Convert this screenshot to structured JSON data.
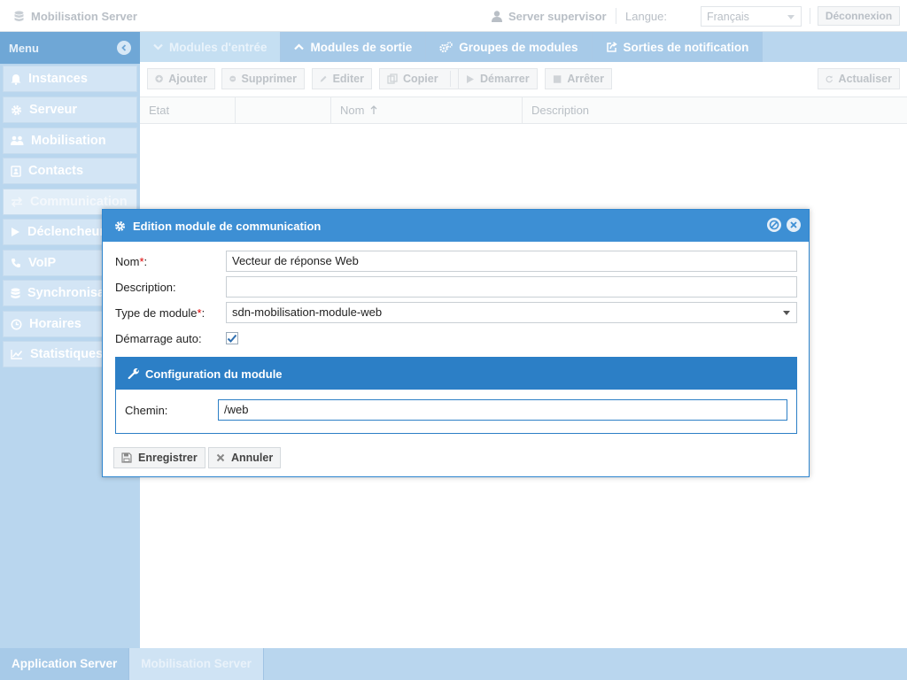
{
  "topbar": {
    "app_title": "Mobilisation Server",
    "user": "Server supervisor",
    "language_label": "Langue:",
    "language_value": "Français",
    "logout_label": "Déconnexion"
  },
  "sidebar": {
    "header": "Menu",
    "items": [
      {
        "label": "Instances",
        "icon": "bell-icon"
      },
      {
        "label": "Serveur",
        "icon": "gear-icon"
      },
      {
        "label": "Mobilisation",
        "icon": "users-icon"
      },
      {
        "label": "Contacts",
        "icon": "contact-card-icon"
      },
      {
        "label": "Communication",
        "icon": "exchange-icon"
      },
      {
        "label": "Déclencheurs",
        "icon": "play-icon"
      },
      {
        "label": "VoIP",
        "icon": "phone-icon"
      },
      {
        "label": "Synchronisation",
        "icon": "database-icon"
      },
      {
        "label": "Horaires",
        "icon": "clock-icon"
      },
      {
        "label": "Statistiques",
        "icon": "chart-line-icon"
      }
    ]
  },
  "tabs": [
    {
      "label": "Modules d'entrée",
      "icon": "chevron-down-icon"
    },
    {
      "label": "Modules de sortie",
      "icon": "chevron-up-icon"
    },
    {
      "label": "Groupes de modules",
      "icon": "gears-icon"
    },
    {
      "label": "Sorties de notification",
      "icon": "share-icon"
    }
  ],
  "toolbar": {
    "add": "Ajouter",
    "delete": "Supprimer",
    "edit": "Editer",
    "copy": "Copier",
    "start": "Démarrer",
    "stop": "Arrêter",
    "refresh": "Actualiser"
  },
  "table": {
    "columns": [
      "Etat",
      "",
      "Nom",
      "Description"
    ]
  },
  "dialog": {
    "title": "Edition module de communication",
    "name_label": "Nom",
    "name_value": "Vecteur de réponse Web",
    "description_label": "Description:",
    "description_value": "",
    "type_label": "Type de module",
    "type_value": "sdn-mobilisation-module-web",
    "autostart_label": "Démarrage auto:",
    "autostart_checked": true,
    "config_title": "Configuration du module",
    "path_label": "Chemin:",
    "path_value": "/web",
    "save_label": "Enregistrer",
    "cancel_label": "Annuler"
  },
  "bottom_tabs": [
    "Application Server",
    "Mobilisation Server"
  ]
}
